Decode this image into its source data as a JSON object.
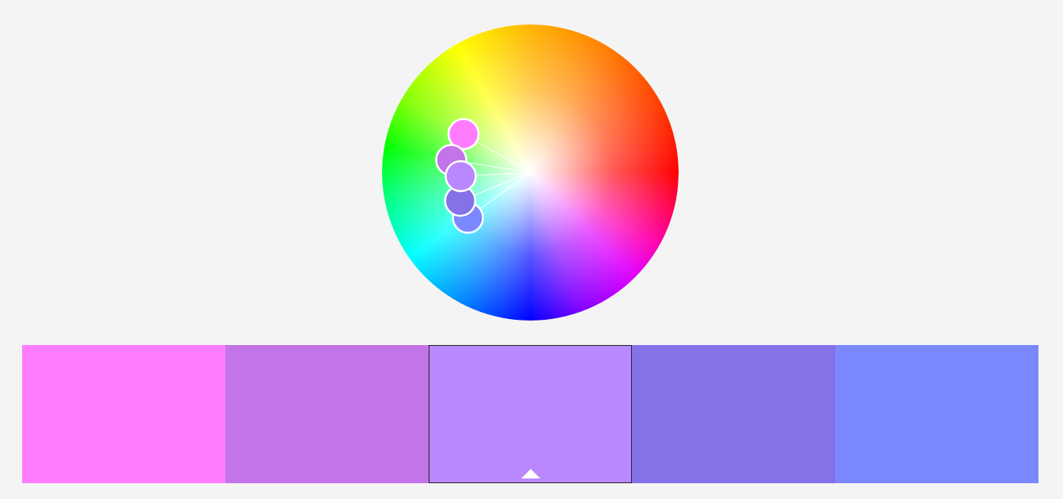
{
  "palette": {
    "selected_index": 2,
    "swatches": [
      {
        "hex": "#FF7CFF",
        "selected": false
      },
      {
        "hex": "#C274E8",
        "selected": false
      },
      {
        "hex": "#B988FE",
        "selected": true
      },
      {
        "hex": "#8472E8",
        "selected": false
      },
      {
        "hex": "#7C88FF",
        "selected": false
      }
    ]
  },
  "wheel": {
    "handles": [
      {
        "swatch_index": 0,
        "hue_deg": 300,
        "saturation": 0.52
      },
      {
        "swatch_index": 1,
        "hue_deg": 279,
        "saturation": 0.54
      },
      {
        "swatch_index": 2,
        "hue_deg": 267,
        "saturation": 0.47
      },
      {
        "swatch_index": 3,
        "hue_deg": 248,
        "saturation": 0.51
      },
      {
        "swatch_index": 4,
        "hue_deg": 234,
        "saturation": 0.52
      }
    ]
  },
  "icons": {
    "selected_indicator": "caret-up-icon"
  }
}
